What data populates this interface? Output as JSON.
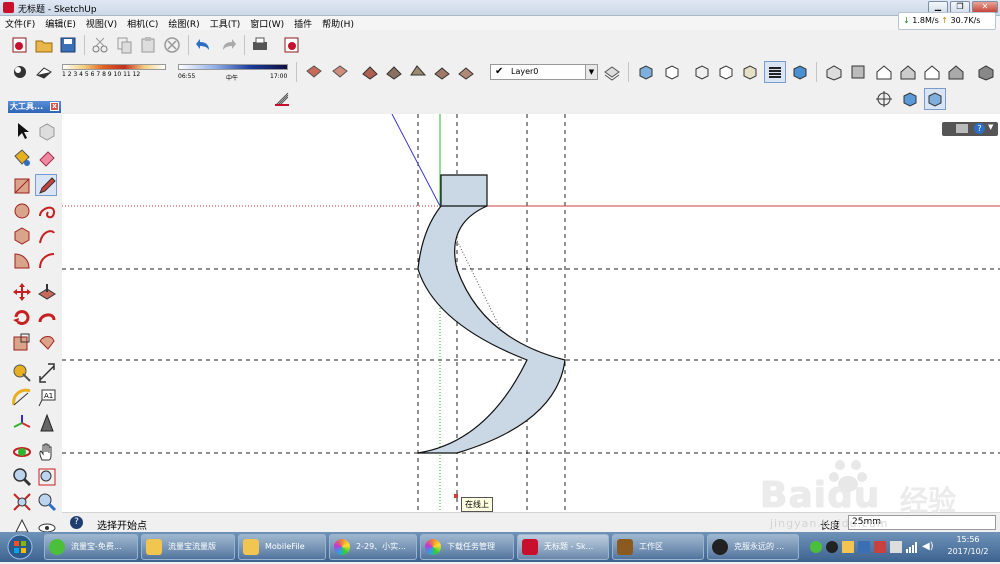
{
  "window": {
    "title": "无标题 - SketchUp"
  },
  "menu": [
    "文件(F)",
    "编辑(E)",
    "视图(V)",
    "相机(C)",
    "绘图(R)",
    "工具(T)",
    "窗口(W)",
    "插件",
    "帮助(H)"
  ],
  "network": {
    "down": "1.8M/s",
    "up": "30.7K/s"
  },
  "shadow": {
    "months": "1 2 3 4 5 6 7 8 9 10 11 12",
    "time_start": "06:55",
    "time_mid": "中午",
    "time_end": "17:00"
  },
  "layer": {
    "name": "Layer0"
  },
  "large_toolset": {
    "title": "大工具..."
  },
  "status": {
    "hint": "选择开始点",
    "length_label": "长度",
    "length_value": "25mm"
  },
  "tooltip": {
    "on_line": "在线上"
  },
  "taskbar": {
    "items": [
      "流量宝-免费...",
      "流量宝流量版",
      "MobileFile",
      "2-29、小实...",
      "下载任务管理",
      "无标题 - Sk...",
      "工作区",
      "克服永远的 ..."
    ],
    "clock_time": "15:56",
    "clock_date": "2017/10/2"
  },
  "watermark": {
    "brand": "Baidu",
    "cn": "经验",
    "url": "jingyan.baidu.com"
  },
  "colors": {
    "shape_fill": "#c9d8e4",
    "red_axis": "#d23c3c",
    "green_axis": "#2fb52f",
    "blue_axis": "#3a3ad6",
    "title_gradient": "#2e64b5",
    "taskbar": "#3d6390"
  }
}
